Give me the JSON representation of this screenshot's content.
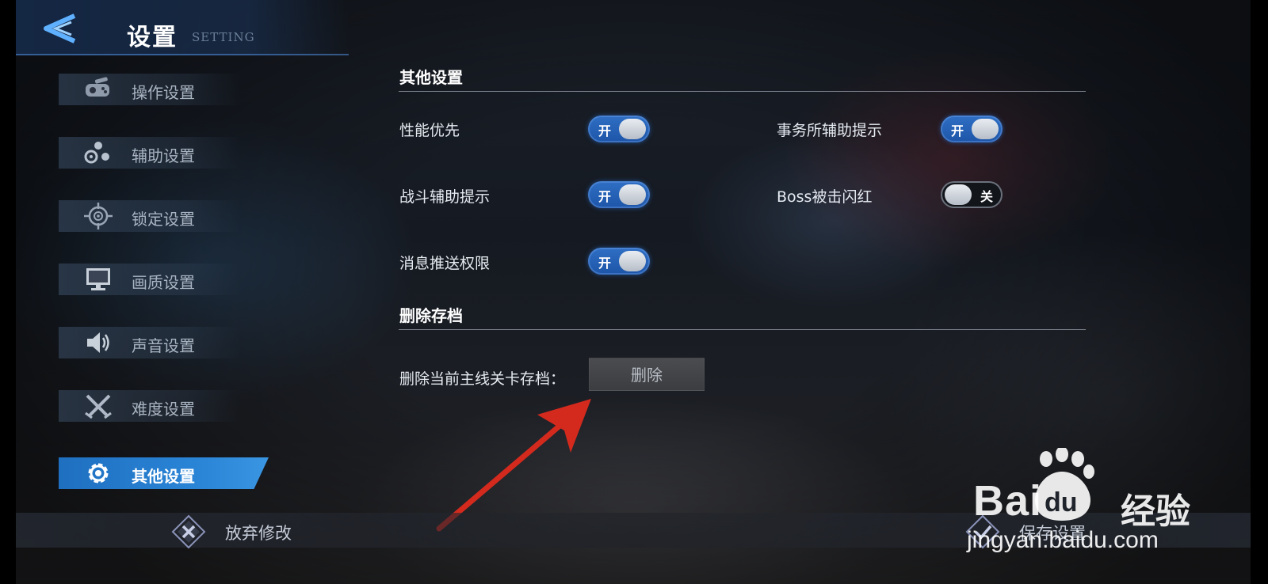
{
  "header": {
    "title": "设置",
    "subtitle": "SETTING"
  },
  "sidebar": {
    "items": [
      {
        "label": "操作设置",
        "icon": "gamepad-icon"
      },
      {
        "label": "辅助设置",
        "icon": "dots-cluster-icon"
      },
      {
        "label": "锁定设置",
        "icon": "crosshair-icon"
      },
      {
        "label": "画质设置",
        "icon": "monitor-icon"
      },
      {
        "label": "声音设置",
        "icon": "speaker-icon"
      },
      {
        "label": "难度设置",
        "icon": "crossed-swords-icon"
      },
      {
        "label": "其他设置",
        "icon": "gear-icon",
        "active": true
      }
    ]
  },
  "other_settings": {
    "title": "其他设置",
    "options": [
      {
        "label": "性能优先",
        "state": "开",
        "on": true
      },
      {
        "label": "事务所辅助提示",
        "state": "开",
        "on": true
      },
      {
        "label": "战斗辅助提示",
        "state": "开",
        "on": true
      },
      {
        "label": "Boss被击闪红",
        "state": "关",
        "on": false
      },
      {
        "label": "消息推送权限",
        "state": "开",
        "on": true
      }
    ]
  },
  "delete_save": {
    "title": "删除存档",
    "label": "删除当前主线关卡存档：",
    "button": "删除"
  },
  "footer": {
    "discard": "放弃修改",
    "save": "保存设置"
  },
  "watermark": {
    "brand": "Bai",
    "brand_cn": "经验",
    "url": "jingyan.baidu.com",
    "brand_du": "du"
  },
  "colors": {
    "accent": "#2b86d8",
    "toggle_on": "#1d55a8",
    "annotation_arrow": "#d42a1e"
  }
}
